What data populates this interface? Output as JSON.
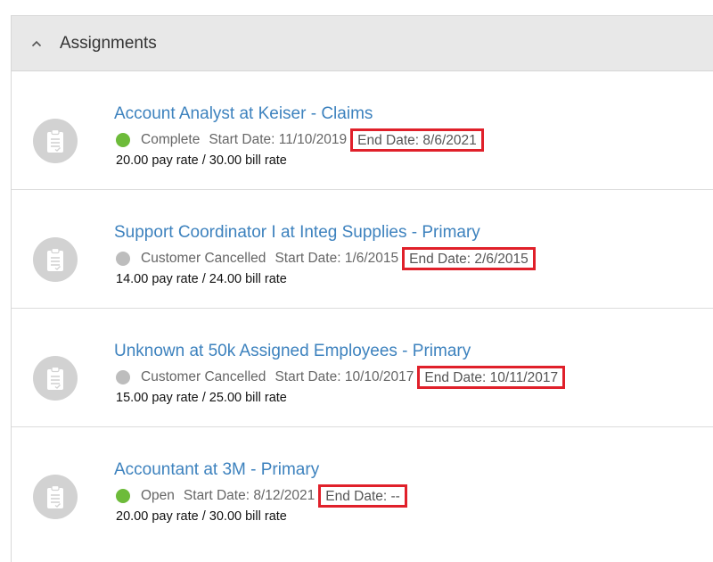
{
  "panel": {
    "title": "Assignments",
    "toggle_icon": "chevron-up-icon"
  },
  "assignments": [
    {
      "title": "Account Analyst at Keiser - Claims",
      "status": "Complete",
      "status_color": "#6dbb3a",
      "start_date": "Start Date: 11/10/2019",
      "end_date": "End Date: 8/6/2021",
      "rates": "20.00 pay rate / 30.00 bill rate",
      "icon": "clipboard-icon"
    },
    {
      "title": "Support Coordinator I at Integ Supplies - Primary",
      "status": "Customer Cancelled",
      "status_color": "#bdbdbd",
      "start_date": "Start Date: 1/6/2015",
      "end_date": "End Date: 2/6/2015",
      "rates": "14.00 pay rate / 24.00 bill rate",
      "icon": "clipboard-icon"
    },
    {
      "title": "Unknown at 50k Assigned Employees - Primary",
      "status": "Customer Cancelled",
      "status_color": "#bdbdbd",
      "start_date": "Start Date: 10/10/2017",
      "end_date": "End Date: 10/11/2017",
      "rates": "15.00 pay rate / 25.00 bill rate",
      "icon": "clipboard-icon"
    },
    {
      "title": "Accountant at 3M - Primary",
      "status": "Open",
      "status_color": "#6dbb3a",
      "start_date": "Start Date: 8/12/2021",
      "end_date": "End Date: --",
      "rates": "20.00 pay rate / 30.00 bill rate",
      "icon": "clipboard-icon"
    }
  ],
  "highlight_color": "#e0202a"
}
